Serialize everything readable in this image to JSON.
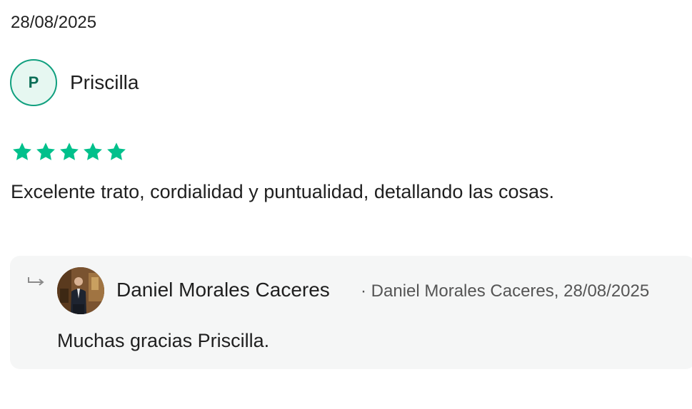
{
  "review": {
    "date": "28/08/2025",
    "author_initial": "P",
    "author_name": "Priscilla",
    "rating": 5,
    "rating_max": 5,
    "text": "Excelente trato, cordialidad y puntualidad, detallando las cosas.",
    "star_color": "#00c08b"
  },
  "reply": {
    "author_name": "Daniel Morales Caceres",
    "meta": "· Daniel Morales Caceres, 28/08/2025",
    "text": "Muchas gracias Priscilla.",
    "icon": "reply-arrow-icon"
  },
  "colors": {
    "accent": "#11a07f",
    "reply_bg": "#f5f6f6"
  }
}
